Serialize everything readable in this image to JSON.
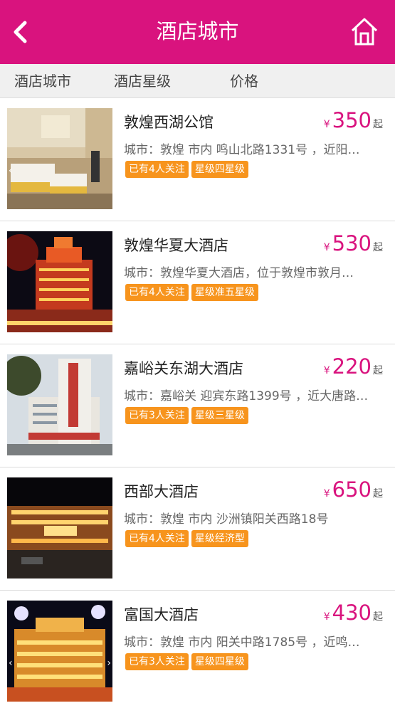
{
  "header": {
    "title": "酒店城市",
    "back_icon": "chevron-left-icon",
    "home_icon": "home-icon",
    "bg_color": "#d9137e"
  },
  "filters": {
    "city": "酒店城市",
    "star": "酒店星级",
    "price": "价格"
  },
  "hotels": [
    {
      "name": "敦煌西湖公馆",
      "currency": "¥",
      "price": "350",
      "price_suffix": "起",
      "address": "城市：敦煌 市内 鸣山北路1331号 ，近阳…",
      "followers": "已有4人关注",
      "star": "星级四星级"
    },
    {
      "name": "敦煌华夏大酒店",
      "currency": "¥",
      "price": "530",
      "price_suffix": "起",
      "address": "城市：敦煌华夏大酒店，位于敦煌市敦月…",
      "followers": "已有4人关注",
      "star": "星级准五星级"
    },
    {
      "name": "嘉峪关东湖大酒店",
      "currency": "¥",
      "price": "220",
      "price_suffix": "起",
      "address": "城市：嘉峪关 迎宾东路1399号 ，近大唐路…",
      "followers": "已有3人关注",
      "star": "星级三星级"
    },
    {
      "name": "西部大酒店",
      "currency": "¥",
      "price": "650",
      "price_suffix": "起",
      "address": "城市：敦煌 市内 沙洲镇阳关西路18号",
      "followers": "已有4人关注",
      "star": "星级经济型"
    },
    {
      "name": "富国大酒店",
      "currency": "¥",
      "price": "430",
      "price_suffix": "起",
      "address": "城市：敦煌 市内 阳关中路1785号 ，近鸣…",
      "followers": "已有3人关注",
      "star": "星级四星级"
    }
  ],
  "colors": {
    "accent": "#d9137e",
    "tag": "#f7941d"
  }
}
